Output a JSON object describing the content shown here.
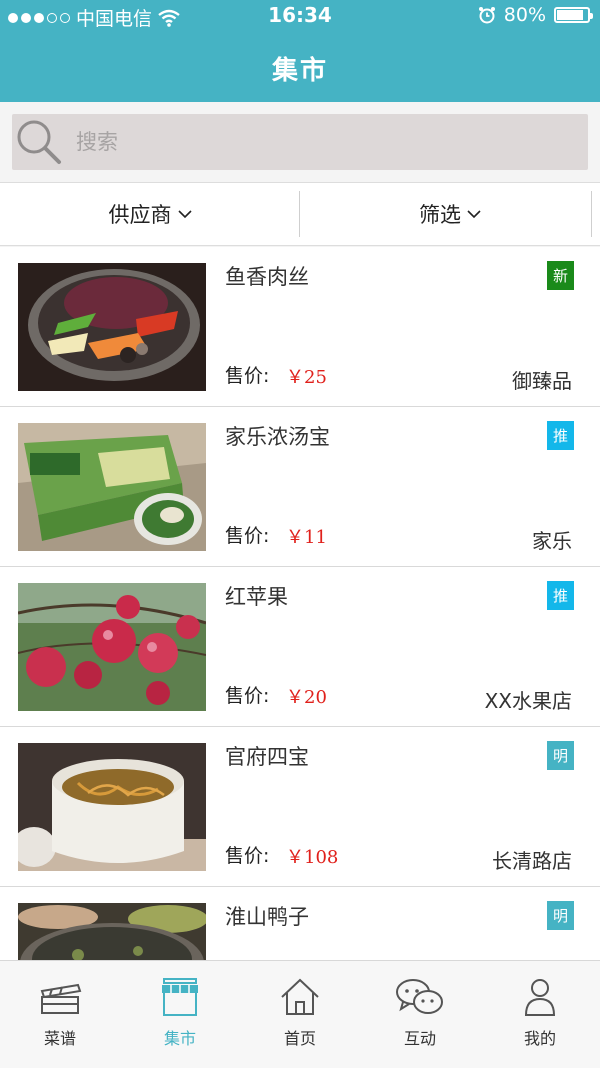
{
  "status_bar": {
    "carrier": "中国电信",
    "time": "16:34",
    "battery": "80%",
    "battery_level": 0.8
  },
  "nav": {
    "title": "集市"
  },
  "search": {
    "placeholder": "搜索"
  },
  "filters": [
    {
      "label": "供应商"
    },
    {
      "label": "筛选"
    }
  ],
  "products": [
    {
      "name": "鱼香肉丝",
      "price_label": "售价:",
      "price": "￥25",
      "shop": "御臻品",
      "badge": "新",
      "badge_color": "#1a8a1a"
    },
    {
      "name": "家乐浓汤宝",
      "price_label": "售价:",
      "price": "￥11",
      "shop": "家乐",
      "badge": "推",
      "badge_color": "#13b7ea"
    },
    {
      "name": "红苹果",
      "price_label": "售价:",
      "price": "￥20",
      "shop": "XX水果店",
      "badge": "推",
      "badge_color": "#13b7ea"
    },
    {
      "name": "官府四宝",
      "price_label": "售价:",
      "price": "￥108",
      "shop": "长清路店",
      "badge": "明",
      "badge_color": "#45b3c4"
    },
    {
      "name": "淮山鸭子",
      "badge": "明",
      "badge_color": "#45b3c4"
    }
  ],
  "tabs": [
    {
      "label": "菜谱",
      "icon": "recipe-box-icon"
    },
    {
      "label": "集市",
      "icon": "market-stall-icon",
      "active": true
    },
    {
      "label": "首页",
      "icon": "home-icon"
    },
    {
      "label": "互动",
      "icon": "chat-bubbles-icon"
    },
    {
      "label": "我的",
      "icon": "user-icon"
    }
  ],
  "colors": {
    "brand": "#45b3c4",
    "price": "#e0201b"
  }
}
